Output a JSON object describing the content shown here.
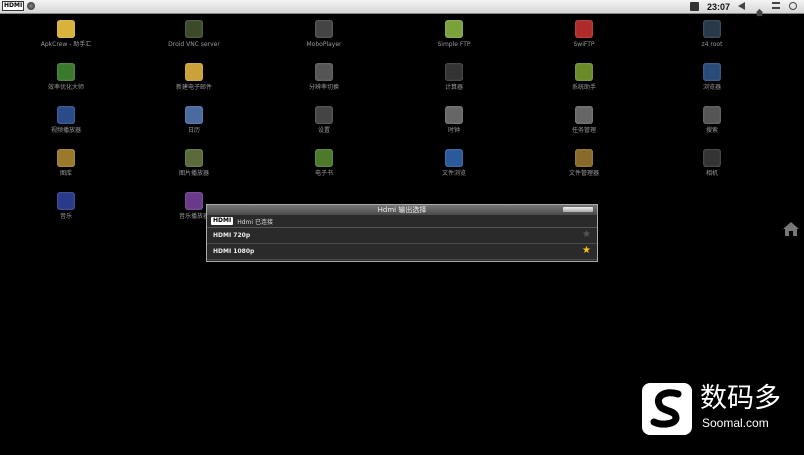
{
  "status_bar": {
    "hdmi_badge": "HDMI",
    "time": "23:07"
  },
  "apps": [
    {
      "label": "ApkCrew - 助手汇",
      "color": "#d8b23a"
    },
    {
      "label": "Droid VNC server",
      "color": "#3c4a2a"
    },
    {
      "label": "MoboPlayer",
      "color": "#444"
    },
    {
      "label": "Simple FTP",
      "color": "#7aa23a"
    },
    {
      "label": "SwiFTP",
      "color": "#b02a2a"
    },
    {
      "label": "z4 root",
      "color": "#283848"
    },
    {
      "label": "效率优化大师",
      "color": "#3a7a2a"
    },
    {
      "label": "新建电子邮件",
      "color": "#c9a23a"
    },
    {
      "label": "分辨率切换",
      "color": "#555"
    },
    {
      "label": "计算器",
      "color": "#333"
    },
    {
      "label": "系统助手",
      "color": "#6a8a2a"
    },
    {
      "label": "浏览器",
      "color": "#2a4a7a"
    },
    {
      "label": "视频播放器",
      "color": "#2a4a8a"
    },
    {
      "label": "日历",
      "color": "#4a6aa0"
    },
    {
      "label": "设置",
      "color": "#444"
    },
    {
      "label": "时钟",
      "color": "#666"
    },
    {
      "label": "任务管理",
      "color": "#666"
    },
    {
      "label": "搜索",
      "color": "#555"
    },
    {
      "label": "图库",
      "color": "#9a7a2a"
    },
    {
      "label": "图片播放器",
      "color": "#5a6a3a"
    },
    {
      "label": "电子书",
      "color": "#4a7a2a"
    },
    {
      "label": "文件浏览",
      "color": "#2a5a9a"
    },
    {
      "label": "文件管理器",
      "color": "#8a6a2a"
    },
    {
      "label": "相机",
      "color": "#333"
    },
    {
      "label": "音乐",
      "color": "#2a3a8a"
    },
    {
      "label": "音乐播放器",
      "color": "#6a3a8a"
    }
  ],
  "dialog": {
    "title": "Hdmi 输出选择",
    "logo": "HDMI",
    "subtitle": "Hdmi 已连接",
    "options": [
      {
        "label": "HDMI 720p",
        "selected": false
      },
      {
        "label": "HDMI 1080p",
        "selected": true
      }
    ],
    "star_glyph": "★"
  },
  "watermark": {
    "cn": "数码多",
    "en": "Soomal.com"
  }
}
